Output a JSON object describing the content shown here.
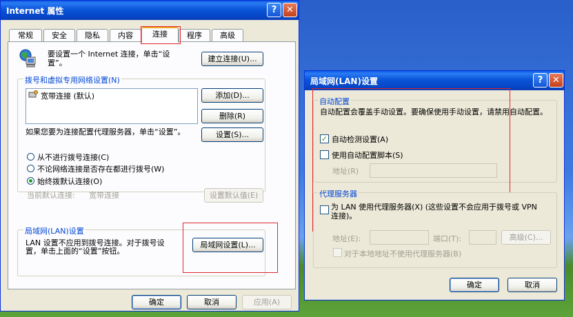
{
  "internet_props": {
    "title": "Internet 属性",
    "help_glyph": "?",
    "close_glyph": "✕",
    "tabs": [
      "常规",
      "安全",
      "隐私",
      "内容",
      "连接",
      "程序",
      "高级"
    ],
    "active_tab": "连接",
    "setup_text": "要设置一个 Internet 连接，单击“设置”。",
    "setup_button": "建立连接(U)...",
    "dialup_group": "拨号和虚拟专用网络设置(N)",
    "connections": [
      "宽带连接 (默认)"
    ],
    "add_button": "添加(D)...",
    "remove_button": "删除(R)",
    "settings_text": "如果您要为连接配置代理服务器，单击“设置”。",
    "settings_button": "设置(S)...",
    "radio_never": "从不进行拨号连接(C)",
    "radio_no_network": "不论网络连接是否存在都进行拨号(W)",
    "radio_always": "始终拨默认连接(O)",
    "current_default_label": "当前默认连接:",
    "current_default_value": "宽带连接",
    "set_default_button": "设置默认值(E)",
    "lan_group": "局域网(LAN)设置",
    "lan_text": "LAN 设置不应用到拨号连接。对于拨号设置，单击上面的“设置”按钮。",
    "lan_button": "局域网设置(L)...",
    "ok_button": "确定",
    "cancel_button": "取消",
    "apply_button": "应用(A)"
  },
  "lan_dialog": {
    "title": "局域网(LAN)设置",
    "help_glyph": "?",
    "close_glyph": "✕",
    "auto_group": "自动配置",
    "auto_text": "自动配置会覆盖手动设置。要确保使用手动设置，请禁用自动配置。",
    "auto_detect_label": "自动检测设置(A)",
    "auto_detect_checked": true,
    "auto_script_label": "使用自动配置脚本(S)",
    "auto_script_checked": false,
    "address_label": "地址(R)",
    "address_value": "",
    "proxy_group": "代理服务器",
    "proxy_label": "为 LAN 使用代理服务器(X) (这些设置不会应用于拨号或 VPN 连接)。",
    "proxy_checked": false,
    "proxy_address_label": "地址(E):",
    "proxy_address_value": "",
    "port_label": "端口(T):",
    "port_value": "",
    "advanced_button": "高级(C)...",
    "bypass_label": "对于本地地址不使用代理服务器(B)",
    "ok_button": "确定",
    "cancel_button": "取消"
  },
  "colors": {
    "xp_blue": "#0a55d8",
    "highlight_red": "#e0242a",
    "dialog_bg": "#ece9d8"
  }
}
